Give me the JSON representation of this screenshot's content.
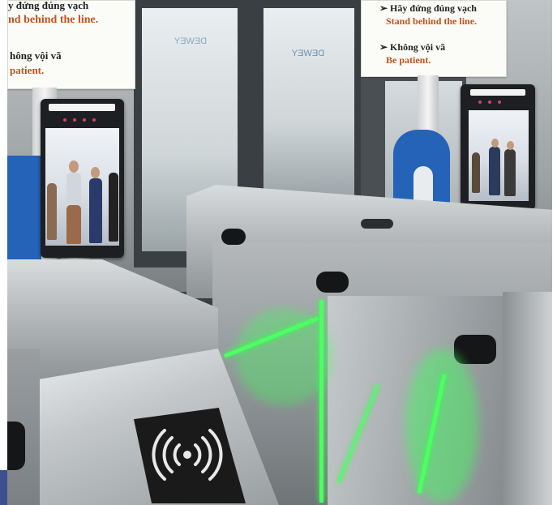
{
  "signs": [
    {
      "vn_line1": "y đứng đúng vạch",
      "en_line1": "nd behind the line.",
      "vn_line2": "hông vội vã",
      "en_line2": "patient."
    },
    {
      "vn_line1": "➢ Hãy đứng đúng vạch",
      "en_line1": "Stand behind the line.",
      "vn_line2": "➢ Không vội vã",
      "en_line2": "Be patient."
    }
  ],
  "door_logo": "DEWEY",
  "colors": {
    "accent_green": "#4cff63",
    "sign_red": "#c2521d",
    "stand_blue": "#2463b8",
    "steel": "#b5b9bb"
  },
  "icons": {
    "nfc_reader": "contactless-waves-icon",
    "face_kiosk_left": "face-recognition-terminal",
    "face_kiosk_right": "face-recognition-terminal"
  }
}
